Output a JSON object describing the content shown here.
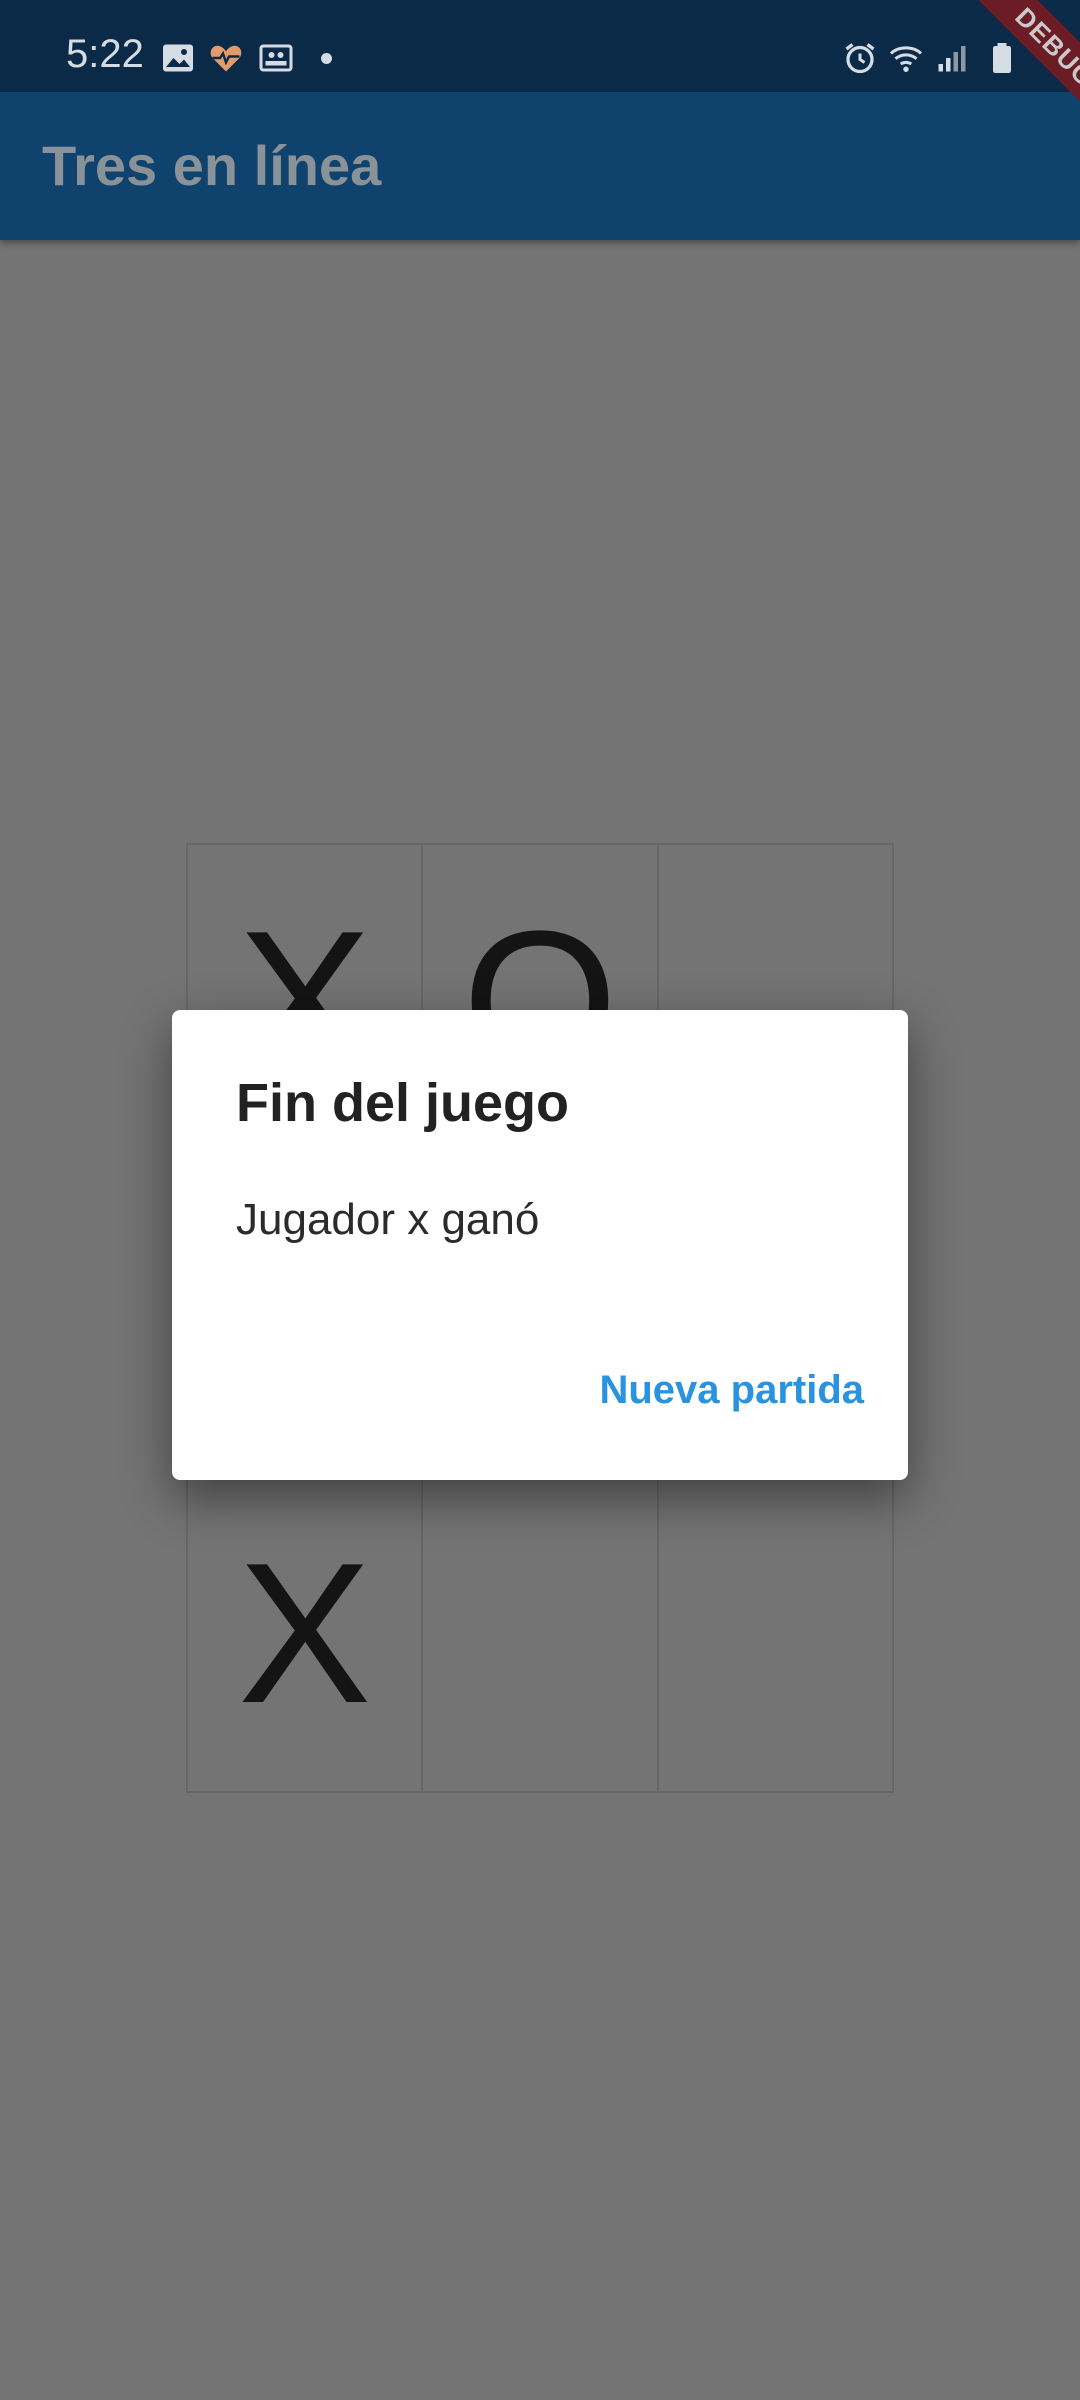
{
  "status_bar": {
    "time": "5:22",
    "icons_left": [
      "image-icon",
      "heart-monitor-icon",
      "photo-frame-icon"
    ],
    "icons_right": [
      "alarm-icon",
      "wifi-icon",
      "signal-icon",
      "battery-icon"
    ]
  },
  "app_bar": {
    "title": "Tres en línea"
  },
  "debug_banner": {
    "label": "DEBUG"
  },
  "board": {
    "cells": [
      "X",
      "O",
      "",
      "",
      "",
      "",
      "X",
      "",
      ""
    ]
  },
  "dialog": {
    "title": "Fin del juego",
    "content": "Jugador x ganó",
    "action_label": "Nueva partida"
  },
  "colors": {
    "status_bar": "#0b2a48",
    "app_bar": "#0f426d",
    "scrim_background": "#747474",
    "dialog_action": "#2a93e0"
  }
}
